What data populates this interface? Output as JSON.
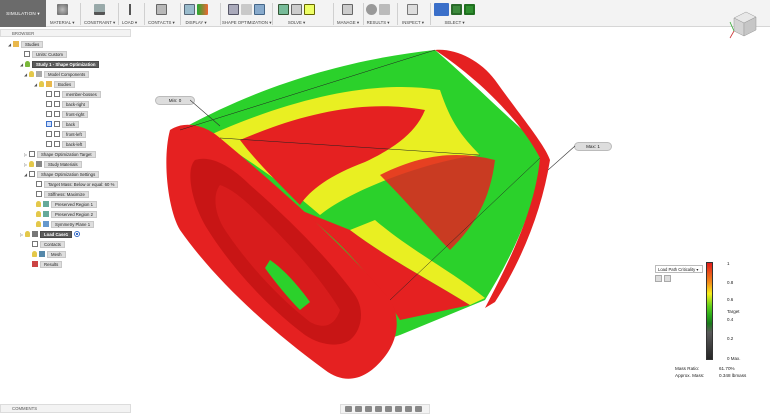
{
  "toolbar": {
    "workspace": "SIMULATION ▾",
    "groups": [
      "MATERIAL ▾",
      "CONSTRAINT ▾",
      "LOAD ▾",
      "CONTACTS ▾",
      "DISPLAY ▾",
      "SHAPE OPTIMIZATION ▾",
      "SOLVE ▾",
      "MANAGE ▾",
      "RESULTS ▾",
      "INSPECT ▾",
      "SELECT ▾"
    ]
  },
  "browser": {
    "title": "BROWSER",
    "items": {
      "studies": "Studies",
      "units": "Units: Custom",
      "study1": "Study 1 - Shape Optimization",
      "model_components": "Model Components",
      "bodies": "Bodies",
      "body_member_bosses": "member-bosses",
      "body_back_right": "back-right",
      "body_front_right": "front-right",
      "body_back": "back",
      "body_front_left": "front-left",
      "body_back_left": "back-left",
      "so_target": "Shape Optimization Target",
      "study_materials": "Study Materials",
      "so_settings": "Shape Optimization Settings",
      "target_mass": "Target Mass: Below or equal: 60 %",
      "stiffness": "Stiffness: Maximize",
      "preserved1": "Preserved Region 1",
      "preserved2": "Preserved Region 2",
      "symmetry": "Symmetry Plane 1",
      "load_case": "Load Case1",
      "contacts": "Contacts",
      "mesh": "Mesh",
      "results": "Results"
    }
  },
  "comments": "COMMENTS",
  "callouts": {
    "min": "Min: 0",
    "max": "Max: 1"
  },
  "legend": {
    "select": "Load Path Criticality ▾",
    "ticks": [
      "1",
      "0.8",
      "0.6",
      "Target",
      "0.4",
      "0.2",
      "0 Max."
    ],
    "mass_ratio_label": "Mass Ratio:",
    "mass_ratio_value": "61.70%",
    "approx_mass_label": "Approx. Mass:",
    "approx_mass_value": "0.348 lbmass",
    "colors": {
      "high": "#e21b1b",
      "mid": "#f7ee1a",
      "low": "#29a81a",
      "none": "#262626"
    }
  }
}
